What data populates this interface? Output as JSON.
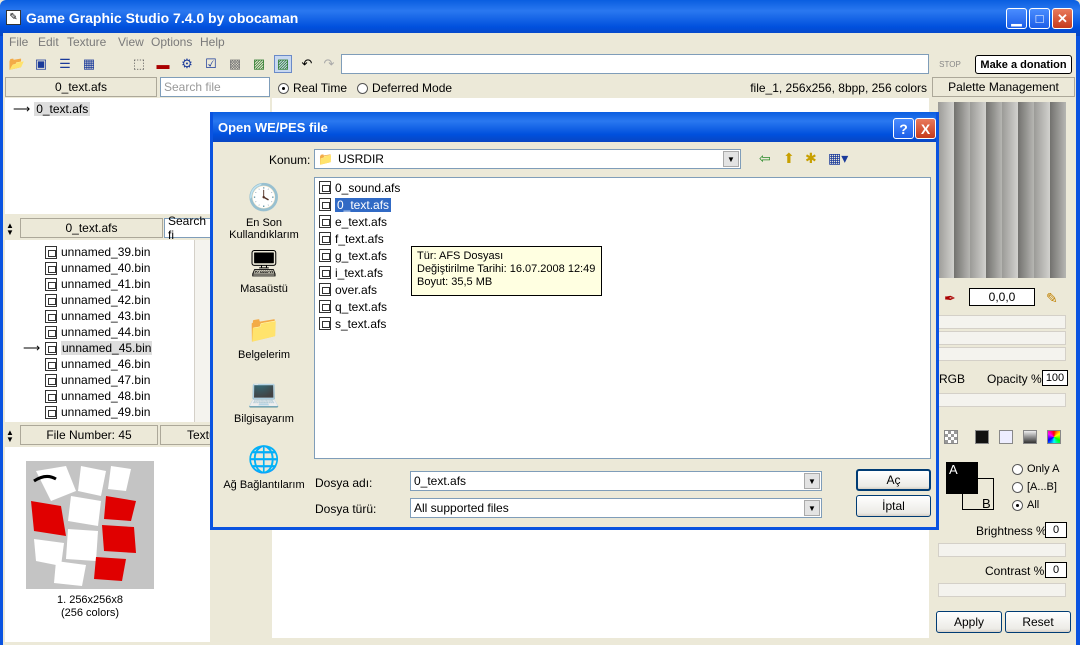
{
  "app": {
    "title": "Game Graphic Studio 7.4.0 by obocaman"
  },
  "menu": [
    "File",
    "Edit",
    "Texture",
    "View",
    "Options",
    "Help"
  ],
  "toolbar": {
    "stop_label": "STOP",
    "donate_label": "Make a donation",
    "path_value": ""
  },
  "top_panel": {
    "tab_label": "0_text.afs",
    "search_placeholder": "Search file",
    "tree_item": "0_text.afs"
  },
  "mid_panel": {
    "tab_label": "0_text.afs",
    "search_placeholder": "Search fi",
    "items": [
      {
        "name": "unnamed_39.bin",
        "current": false
      },
      {
        "name": "unnamed_40.bin",
        "current": false
      },
      {
        "name": "unnamed_41.bin",
        "current": false
      },
      {
        "name": "unnamed_42.bin",
        "current": false
      },
      {
        "name": "unnamed_43.bin",
        "current": false
      },
      {
        "name": "unnamed_44.bin",
        "current": false
      },
      {
        "name": "unnamed_45.bin",
        "current": true
      },
      {
        "name": "unnamed_46.bin",
        "current": false
      },
      {
        "name": "unnamed_47.bin",
        "current": false
      },
      {
        "name": "unnamed_48.bin",
        "current": false
      },
      {
        "name": "unnamed_49.bin",
        "current": false
      }
    ],
    "file_number": "File Number: 45",
    "texture_tab": "Textu"
  },
  "thumbnail": {
    "caption_line1": "1. 256x256x8",
    "caption_line2": "(256 colors)"
  },
  "view": {
    "mode_realtime": "Real Time",
    "mode_deferred": "Deferred Mode",
    "file_info": "file_1, 256x256, 8bpp, 256 colors"
  },
  "palette": {
    "title": "Palette Management",
    "color_value": "0,0,0",
    "rgb_label": "RGB",
    "opacity_label": "Opacity %",
    "opacity_value": "100",
    "swatch_a": "A",
    "swatch_b": "B",
    "only_a": "Only A",
    "range": "[A...B]",
    "all": "All",
    "brightness_label": "Brightness %",
    "brightness_value": "0",
    "contrast_label": "Contrast %",
    "contrast_value": "0",
    "apply": "Apply",
    "reset": "Reset"
  },
  "dialog": {
    "title": "Open WE/PES file",
    "location_label": "Konum:",
    "location_value": "USRDIR",
    "places": [
      {
        "label": "En Son Kullandıklarım",
        "icon": "recent-icon"
      },
      {
        "label": "Masaüstü",
        "icon": "desktop-icon"
      },
      {
        "label": "Belgelerim",
        "icon": "documents-icon"
      },
      {
        "label": "Bilgisayarım",
        "icon": "computer-icon"
      },
      {
        "label": "Ağ Bağlantılarım",
        "icon": "network-icon"
      }
    ],
    "files": [
      "0_sound.afs",
      "0_text.afs",
      "e_text.afs",
      "f_text.afs",
      "g_text.afs",
      "i_text.afs",
      "over.afs",
      "q_text.afs",
      "s_text.afs"
    ],
    "selected_file": "0_text.afs",
    "tooltip": {
      "line1": "Tür: AFS Dosyası",
      "line2": "Değiştirilme Tarihi: 16.07.2008 12:49",
      "line3": "Boyut: 35,5 MB"
    },
    "filename_label": "Dosya adı:",
    "filename_value": "0_text.afs",
    "filetype_label": "Dosya türü:",
    "filetype_value": "All supported files",
    "open_button": "Aç",
    "cancel_button": "İptal",
    "help_button": "?",
    "close_button": "X"
  }
}
